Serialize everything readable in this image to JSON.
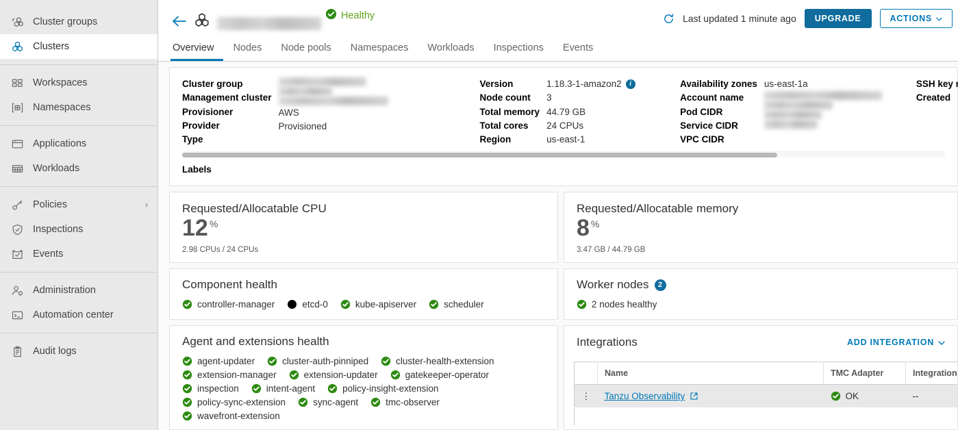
{
  "sidebar": {
    "groups": [
      {
        "items": [
          {
            "label": "Cluster groups",
            "icon": "cluster-groups-icon",
            "selected": false
          },
          {
            "label": "Clusters",
            "icon": "clusters-icon",
            "selected": true
          }
        ]
      },
      {
        "items": [
          {
            "label": "Workspaces",
            "icon": "workspaces-icon",
            "selected": false
          },
          {
            "label": "Namespaces",
            "icon": "namespaces-icon",
            "selected": false
          }
        ]
      },
      {
        "items": [
          {
            "label": "Applications",
            "icon": "applications-icon",
            "selected": false
          },
          {
            "label": "Workloads",
            "icon": "workloads-icon",
            "selected": false
          }
        ]
      },
      {
        "items": [
          {
            "label": "Policies",
            "icon": "policies-icon",
            "selected": false,
            "caret": "›"
          },
          {
            "label": "Inspections",
            "icon": "inspections-icon",
            "selected": false
          },
          {
            "label": "Events",
            "icon": "events-icon",
            "selected": false
          }
        ]
      },
      {
        "items": [
          {
            "label": "Administration",
            "icon": "administration-icon",
            "selected": false
          },
          {
            "label": "Automation center",
            "icon": "automation-center-icon",
            "selected": false
          }
        ]
      },
      {
        "items": [
          {
            "label": "Audit logs",
            "icon": "audit-logs-icon",
            "selected": false
          }
        ]
      }
    ]
  },
  "header": {
    "back_icon": "back-arrow-icon",
    "cluster_icon": "cluster-icon",
    "cluster_name": "",
    "status": "Healthy",
    "status_icon": "check-circle-icon",
    "refresh_icon": "refresh-icon",
    "last_updated": "Last updated 1 minute ago",
    "upgrade_label": "UPGRADE",
    "actions_label": "ACTIONS",
    "actions_caret": "⌄"
  },
  "tabs": [
    {
      "label": "Overview",
      "active": true
    },
    {
      "label": "Nodes",
      "active": false
    },
    {
      "label": "Node pools",
      "active": false
    },
    {
      "label": "Namespaces",
      "active": false
    },
    {
      "label": "Workloads",
      "active": false
    },
    {
      "label": "Inspections",
      "active": false
    },
    {
      "label": "Events",
      "active": false
    }
  ],
  "details": {
    "col1": {
      "keys": [
        "Cluster group",
        "Management cluster",
        "Provisioner",
        "Provider",
        "Type"
      ],
      "values": [
        "",
        "",
        "",
        "AWS",
        "Provisioned"
      ],
      "redacted": [
        true,
        true,
        true,
        false,
        false
      ],
      "redact_widths": [
        128,
        78,
        160,
        0,
        0
      ]
    },
    "col2": {
      "keys": [
        "Version",
        "Node count",
        "Total memory",
        "Total cores",
        "Region"
      ],
      "values": [
        "1.18.3-1-amazon2",
        "3",
        "44.79 GB",
        "24 CPUs",
        "us-east-1"
      ],
      "redacted": [
        false,
        false,
        false,
        false,
        false
      ],
      "info_on_first": true,
      "info_icon": "info-icon"
    },
    "col3": {
      "keys": [
        "Availability zones",
        "Account name",
        "Pod CIDR",
        "Service CIDR",
        "VPC CIDR"
      ],
      "values": [
        "us-east-1a",
        "",
        "",
        "",
        ""
      ],
      "redacted": [
        false,
        true,
        true,
        true,
        true
      ],
      "redact_widths": [
        0,
        172,
        100,
        84,
        78
      ]
    },
    "col4": {
      "keys": [
        "SSH key name",
        "Created"
      ],
      "values": [
        "",
        ""
      ],
      "redacted": [
        false,
        false
      ]
    },
    "labels_title": "Labels",
    "scrollbar": "horizontal-scrollbar"
  },
  "cpu_card": {
    "title": "Requested/Allocatable CPU",
    "value": "12",
    "unit": "%",
    "sub": "2.98 CPUs / 24 CPUs"
  },
  "memory_card": {
    "title": "Requested/Allocatable memory",
    "value": "8",
    "unit": "%",
    "sub": "3.47 GB / 44.79 GB"
  },
  "component_health": {
    "title": "Component health",
    "items": [
      {
        "label": "controller-manager",
        "state": "ok"
      },
      {
        "label": "etcd-0",
        "state": "unknown"
      },
      {
        "label": "kube-apiserver",
        "state": "ok"
      },
      {
        "label": "scheduler",
        "state": "ok"
      }
    ]
  },
  "worker_nodes": {
    "title": "Worker nodes",
    "count": "2",
    "status_label": "2 nodes healthy",
    "status_icon": "check-circle-icon"
  },
  "agent_health": {
    "title": "Agent and extensions health",
    "items": [
      {
        "label": "agent-updater",
        "state": "ok"
      },
      {
        "label": "cluster-auth-pinniped",
        "state": "ok"
      },
      {
        "label": "cluster-health-extension",
        "state": "ok"
      },
      {
        "label": "extension-manager",
        "state": "ok"
      },
      {
        "label": "extension-updater",
        "state": "ok"
      },
      {
        "label": "gatekeeper-operator",
        "state": "ok"
      },
      {
        "label": "inspection",
        "state": "ok"
      },
      {
        "label": "intent-agent",
        "state": "ok"
      },
      {
        "label": "policy-insight-extension",
        "state": "ok"
      },
      {
        "label": "policy-sync-extension",
        "state": "ok"
      },
      {
        "label": "sync-agent",
        "state": "ok"
      },
      {
        "label": "tmc-observer",
        "state": "ok"
      },
      {
        "label": "wavefront-extension",
        "state": "ok"
      }
    ]
  },
  "integrations": {
    "title": "Integrations",
    "add_label": "ADD INTEGRATION",
    "add_caret": "⌄",
    "columns": [
      "",
      "Name",
      "TMC Adapter",
      "Integration W"
    ],
    "rows": [
      {
        "kebab": "⋮",
        "name": "Tanzu Observability",
        "external_icon": "external-link-icon",
        "adapter_status": "OK",
        "adapter_icon": "check-circle-icon",
        "wavefront": "--"
      }
    ]
  },
  "colors": {
    "accent_blue": "#0079b8",
    "primary_button": "#0f6c9d",
    "healthy_green": "#62a420",
    "status_green": "#2e8b12",
    "sidebar_bg": "#e9e9e9",
    "page_bg": "#fafafa"
  }
}
